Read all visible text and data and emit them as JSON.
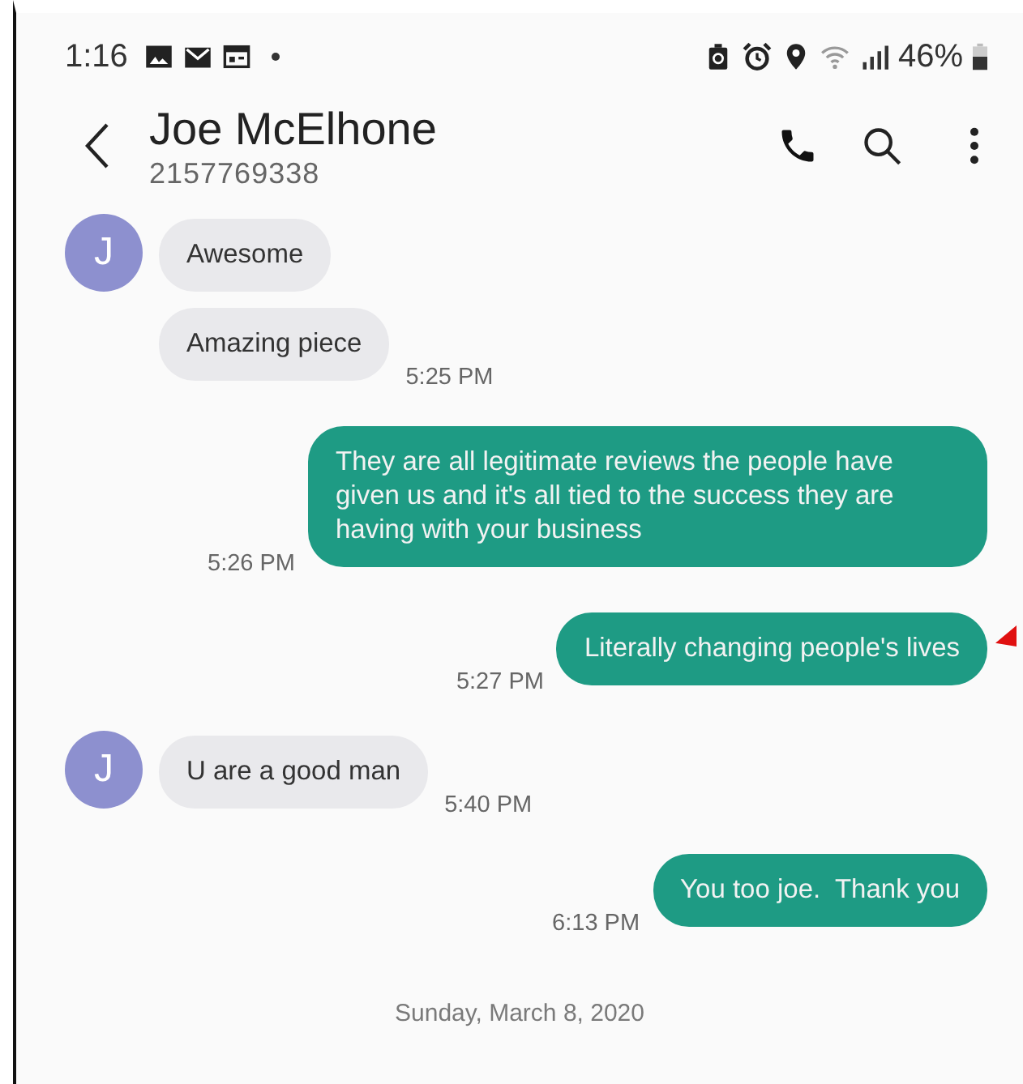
{
  "status_bar": {
    "time": "1:16",
    "battery": "46%"
  },
  "header": {
    "name": "Joe McElhone",
    "number": "2157769338"
  },
  "messages": [
    {
      "kind": "incoming",
      "avatar": "J",
      "text": "Awesome"
    },
    {
      "kind": "incoming",
      "text": "Amazing piece",
      "time": "5:25 PM"
    },
    {
      "kind": "outgoing",
      "text": "They are all legitimate reviews the people have given us and it's all tied to the success they are having with your business",
      "time": "5:26 PM"
    },
    {
      "kind": "outgoing",
      "text": "Literally changing people's lives",
      "time": "5:27 PM"
    },
    {
      "kind": "incoming",
      "avatar": "J",
      "text": "U are a good man",
      "time": "5:40 PM"
    },
    {
      "kind": "outgoing",
      "text": "You too joe.  Thank you",
      "time": "6:13 PM"
    }
  ],
  "date_divider": "Sunday, March 8, 2020"
}
